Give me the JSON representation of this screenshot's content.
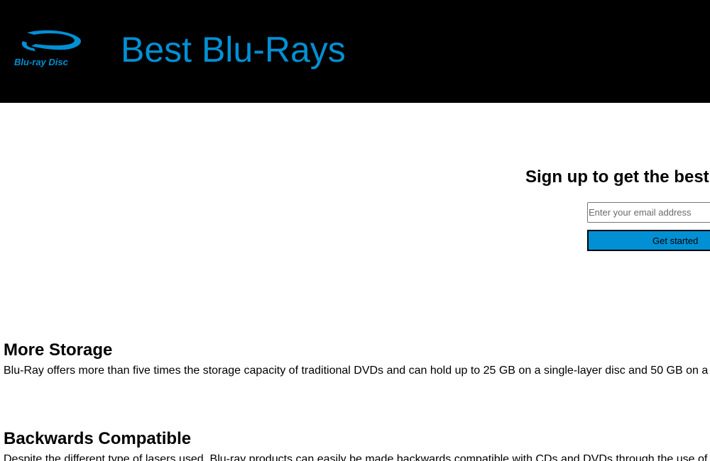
{
  "header": {
    "logo_text": "Blu-ray Disc",
    "title": "Best Blu-Rays"
  },
  "signup": {
    "heading": "Sign up to get the best",
    "email_placeholder": "Enter your email address",
    "button_label": "Get started"
  },
  "features": [
    {
      "title": "More Storage",
      "body": "Blu-Ray offers more than five times the storage capacity of traditional DVDs and can hold up to 25 GB on a single-layer disc and 50 GB on a"
    },
    {
      "title": "Backwards Compatible",
      "body": "Despite the different type of lasers used, Blu-ray products can easily be made backwards compatible with CDs and DVDs through the use of"
    }
  ],
  "colors": {
    "header_background": "#000000",
    "brand_blue": "#0190d4",
    "page_background": "#ffffff"
  },
  "icons": {
    "logo": "blu-ray-disc-logo"
  }
}
